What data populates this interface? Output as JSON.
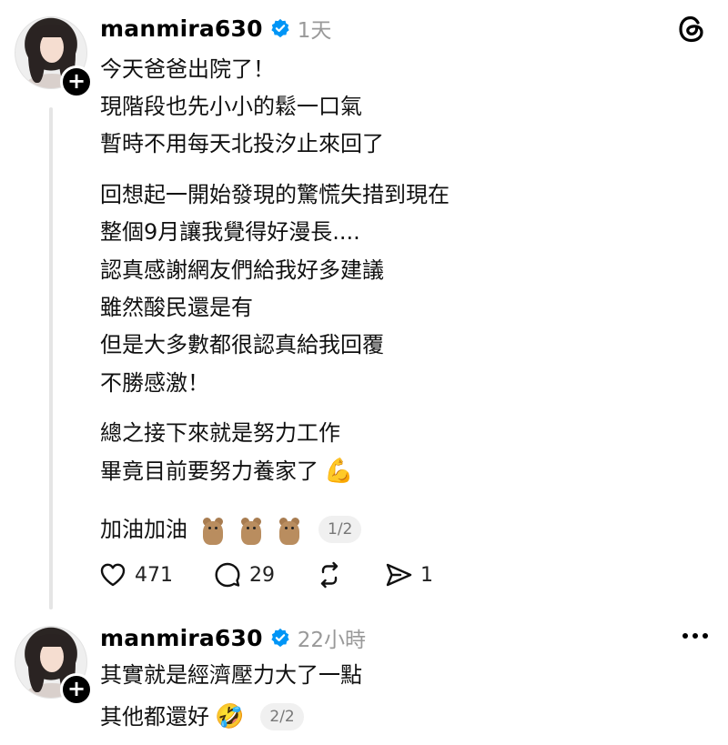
{
  "post1": {
    "username": "manmira630",
    "time": "1天",
    "follow_symbol": "+",
    "lines": [
      "今天爸爸出院了！",
      "現階段也先小小的鬆一口氣",
      "暫時不用每天北投汐止來回了",
      "回想起一開始發現的驚慌失措到現在",
      "整個9月讓我覺得好漫長....",
      "認真感謝網友們給我好多建議",
      "雖然酸民還是有",
      "但是大多數都很認真給我回覆",
      "不勝感激！",
      "總之接下來就是努力工作",
      "畢竟目前要努力養家了",
      "加油加油"
    ],
    "flex_emoji": "💪",
    "pager": "1/2",
    "actions": {
      "likes": "471",
      "comments": "29",
      "shares": "1"
    }
  },
  "post2": {
    "username": "manmira630",
    "time": "22小時",
    "follow_symbol": "+",
    "lines": [
      "其實就是經濟壓力大了一點",
      "其他都還好"
    ],
    "laugh_emoji": "🤣",
    "pager": "2/2"
  },
  "icons": {
    "verified": "verified-badge-icon",
    "threads": "threads-logo-icon",
    "more": "more-options-icon",
    "like": "heart-icon",
    "comment": "comment-icon",
    "repost": "repost-icon",
    "share": "share-icon"
  },
  "colors": {
    "verified_blue": "#0095f6",
    "secondary_text": "#999999",
    "thread_line": "#e5e5e5"
  }
}
